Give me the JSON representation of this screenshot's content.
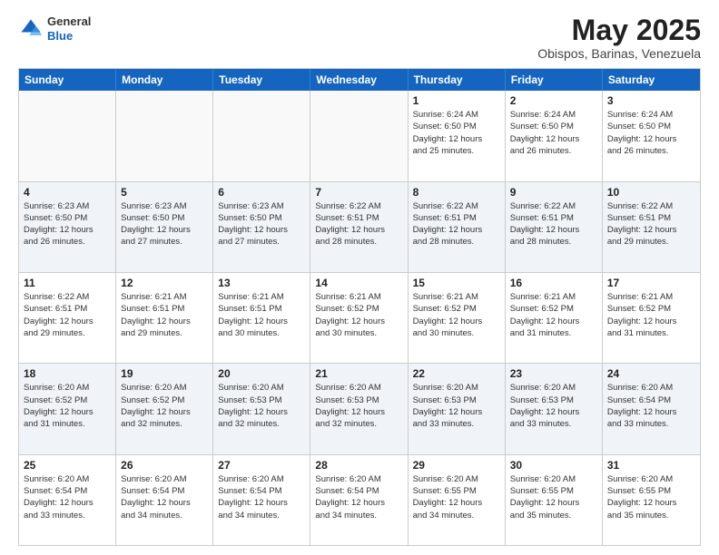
{
  "header": {
    "logo": {
      "general": "General",
      "blue": "Blue"
    },
    "title": "May 2025",
    "location": "Obispos, Barinas, Venezuela"
  },
  "days_of_week": [
    "Sunday",
    "Monday",
    "Tuesday",
    "Wednesday",
    "Thursday",
    "Friday",
    "Saturday"
  ],
  "weeks": [
    [
      {
        "day": "",
        "empty": true
      },
      {
        "day": "",
        "empty": true
      },
      {
        "day": "",
        "empty": true
      },
      {
        "day": "",
        "empty": true
      },
      {
        "day": "1",
        "sunrise": "6:24 AM",
        "sunset": "6:50 PM",
        "daylight": "12 hours and 25 minutes."
      },
      {
        "day": "2",
        "sunrise": "6:24 AM",
        "sunset": "6:50 PM",
        "daylight": "12 hours and 26 minutes."
      },
      {
        "day": "3",
        "sunrise": "6:24 AM",
        "sunset": "6:50 PM",
        "daylight": "12 hours and 26 minutes."
      }
    ],
    [
      {
        "day": "4",
        "sunrise": "6:23 AM",
        "sunset": "6:50 PM",
        "daylight": "12 hours and 26 minutes."
      },
      {
        "day": "5",
        "sunrise": "6:23 AM",
        "sunset": "6:50 PM",
        "daylight": "12 hours and 27 minutes."
      },
      {
        "day": "6",
        "sunrise": "6:23 AM",
        "sunset": "6:50 PM",
        "daylight": "12 hours and 27 minutes."
      },
      {
        "day": "7",
        "sunrise": "6:22 AM",
        "sunset": "6:51 PM",
        "daylight": "12 hours and 28 minutes."
      },
      {
        "day": "8",
        "sunrise": "6:22 AM",
        "sunset": "6:51 PM",
        "daylight": "12 hours and 28 minutes."
      },
      {
        "day": "9",
        "sunrise": "6:22 AM",
        "sunset": "6:51 PM",
        "daylight": "12 hours and 28 minutes."
      },
      {
        "day": "10",
        "sunrise": "6:22 AM",
        "sunset": "6:51 PM",
        "daylight": "12 hours and 29 minutes."
      }
    ],
    [
      {
        "day": "11",
        "sunrise": "6:22 AM",
        "sunset": "6:51 PM",
        "daylight": "12 hours and 29 minutes."
      },
      {
        "day": "12",
        "sunrise": "6:21 AM",
        "sunset": "6:51 PM",
        "daylight": "12 hours and 29 minutes."
      },
      {
        "day": "13",
        "sunrise": "6:21 AM",
        "sunset": "6:51 PM",
        "daylight": "12 hours and 30 minutes."
      },
      {
        "day": "14",
        "sunrise": "6:21 AM",
        "sunset": "6:52 PM",
        "daylight": "12 hours and 30 minutes."
      },
      {
        "day": "15",
        "sunrise": "6:21 AM",
        "sunset": "6:52 PM",
        "daylight": "12 hours and 30 minutes."
      },
      {
        "day": "16",
        "sunrise": "6:21 AM",
        "sunset": "6:52 PM",
        "daylight": "12 hours and 31 minutes."
      },
      {
        "day": "17",
        "sunrise": "6:21 AM",
        "sunset": "6:52 PM",
        "daylight": "12 hours and 31 minutes."
      }
    ],
    [
      {
        "day": "18",
        "sunrise": "6:20 AM",
        "sunset": "6:52 PM",
        "daylight": "12 hours and 31 minutes."
      },
      {
        "day": "19",
        "sunrise": "6:20 AM",
        "sunset": "6:52 PM",
        "daylight": "12 hours and 32 minutes."
      },
      {
        "day": "20",
        "sunrise": "6:20 AM",
        "sunset": "6:53 PM",
        "daylight": "12 hours and 32 minutes."
      },
      {
        "day": "21",
        "sunrise": "6:20 AM",
        "sunset": "6:53 PM",
        "daylight": "12 hours and 32 minutes."
      },
      {
        "day": "22",
        "sunrise": "6:20 AM",
        "sunset": "6:53 PM",
        "daylight": "12 hours and 33 minutes."
      },
      {
        "day": "23",
        "sunrise": "6:20 AM",
        "sunset": "6:53 PM",
        "daylight": "12 hours and 33 minutes."
      },
      {
        "day": "24",
        "sunrise": "6:20 AM",
        "sunset": "6:54 PM",
        "daylight": "12 hours and 33 minutes."
      }
    ],
    [
      {
        "day": "25",
        "sunrise": "6:20 AM",
        "sunset": "6:54 PM",
        "daylight": "12 hours and 33 minutes."
      },
      {
        "day": "26",
        "sunrise": "6:20 AM",
        "sunset": "6:54 PM",
        "daylight": "12 hours and 34 minutes."
      },
      {
        "day": "27",
        "sunrise": "6:20 AM",
        "sunset": "6:54 PM",
        "daylight": "12 hours and 34 minutes."
      },
      {
        "day": "28",
        "sunrise": "6:20 AM",
        "sunset": "6:54 PM",
        "daylight": "12 hours and 34 minutes."
      },
      {
        "day": "29",
        "sunrise": "6:20 AM",
        "sunset": "6:55 PM",
        "daylight": "12 hours and 34 minutes."
      },
      {
        "day": "30",
        "sunrise": "6:20 AM",
        "sunset": "6:55 PM",
        "daylight": "12 hours and 35 minutes."
      },
      {
        "day": "31",
        "sunrise": "6:20 AM",
        "sunset": "6:55 PM",
        "daylight": "12 hours and 35 minutes."
      }
    ]
  ],
  "labels": {
    "sunrise": "Sunrise:",
    "sunset": "Sunset:",
    "daylight": "Daylight:"
  },
  "colors": {
    "header_bg": "#1565C0",
    "alt_row_bg": "#eef2f7"
  }
}
